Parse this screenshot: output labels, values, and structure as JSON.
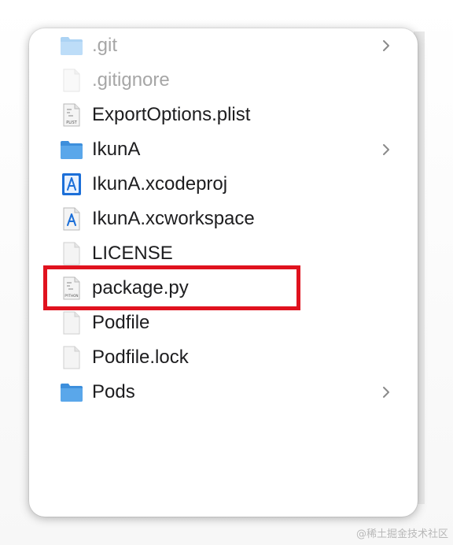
{
  "files": [
    {
      "label": ".git",
      "icon": "folder-icon",
      "expandable": true,
      "dimmed": true
    },
    {
      "label": ".gitignore",
      "icon": "document-icon",
      "expandable": false,
      "dimmed": true
    },
    {
      "label": "ExportOptions.plist",
      "icon": "plist-file-icon",
      "expandable": false,
      "dimmed": false,
      "badge": "PLIST"
    },
    {
      "label": "IkunA",
      "icon": "folder-icon",
      "expandable": true,
      "dimmed": false
    },
    {
      "label": "IkunA.xcodeproj",
      "icon": "xcodeproj-icon",
      "expandable": false,
      "dimmed": false
    },
    {
      "label": "IkunA.xcworkspace",
      "icon": "xcworkspace-icon",
      "expandable": false,
      "dimmed": false
    },
    {
      "label": "LICENSE",
      "icon": "document-icon",
      "expandable": false,
      "dimmed": false
    },
    {
      "label": "package.py",
      "icon": "python-file-icon",
      "expandable": false,
      "dimmed": false,
      "badge": "PYTHON",
      "highlighted": true
    },
    {
      "label": "Podfile",
      "icon": "document-icon",
      "expandable": false,
      "dimmed": false
    },
    {
      "label": "Podfile.lock",
      "icon": "document-icon",
      "expandable": false,
      "dimmed": false
    },
    {
      "label": "Pods",
      "icon": "folder-icon",
      "expandable": true,
      "dimmed": false
    }
  ],
  "colors": {
    "folder": "#5aa7ea",
    "highlight": "#e0121e",
    "xcode_blue": "#1c6fd8"
  },
  "watermark": "@稀土掘金技术社区"
}
